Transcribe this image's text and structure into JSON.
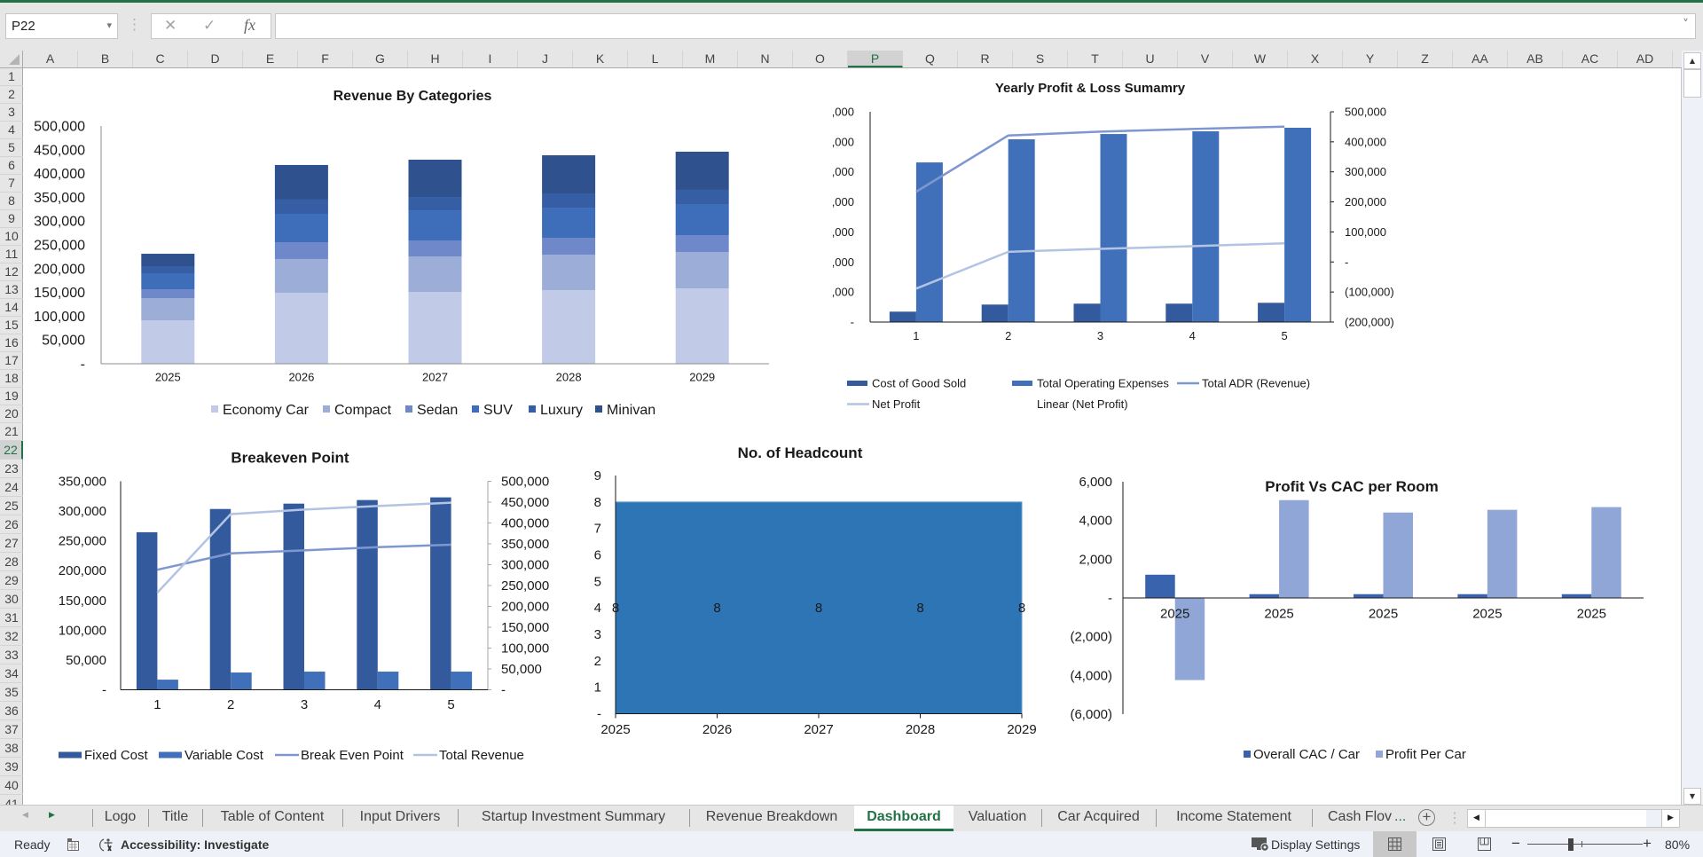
{
  "theme": {
    "accent": "#217346"
  },
  "formula_bar": {
    "name_box": "P22",
    "formula": "",
    "icons": {
      "name_box_dropdown": "▾",
      "grip": "⋮",
      "cancel": "✕",
      "enter": "✓",
      "insert_function": "fx",
      "expand_formula": "˅"
    }
  },
  "grid": {
    "columns": [
      "A",
      "B",
      "C",
      "D",
      "E",
      "F",
      "G",
      "H",
      "I",
      "J",
      "K",
      "L",
      "M",
      "N",
      "O",
      "P",
      "Q",
      "R",
      "S",
      "T",
      "U",
      "V",
      "W",
      "X",
      "Y",
      "Z",
      "AA",
      "AB",
      "AC",
      "AD"
    ],
    "rows": [
      "1",
      "2",
      "3",
      "4",
      "5",
      "6",
      "7",
      "8",
      "9",
      "10",
      "11",
      "12",
      "13",
      "14",
      "15",
      "16",
      "17",
      "18",
      "19",
      "20",
      "21",
      "22",
      "23",
      "24",
      "25",
      "26",
      "27",
      "28",
      "29",
      "30",
      "31",
      "32",
      "33",
      "34",
      "35",
      "36",
      "37",
      "38",
      "39",
      "40",
      "41"
    ],
    "selected_column": "P",
    "selected_row": "22"
  },
  "scrollbars": {
    "up_icon": "▲",
    "down_icon": "▼",
    "left_icon": "◀",
    "right_icon": "▶"
  },
  "sheet_tabs": {
    "prev_icon": "◀",
    "next_icon": "▶",
    "tabs": [
      {
        "label": "Logo"
      },
      {
        "label": "Title"
      },
      {
        "label": "Table of Content"
      },
      {
        "label": "Input Drivers"
      },
      {
        "label": "Startup Investment Summary"
      },
      {
        "label": "Revenue Breakdown"
      },
      {
        "label": "Dashboard"
      },
      {
        "label": "Valuation"
      },
      {
        "label": "Car Acquired"
      },
      {
        "label": "Income Statement"
      },
      {
        "label": "Cash Flov"
      }
    ],
    "active_tab": "Dashboard",
    "overflow_indicator": "...",
    "add_icon": "+",
    "options_icon": "⋮"
  },
  "status_bar": {
    "mode": "Ready",
    "accessibility": "Accessibility: Investigate",
    "display_settings": "Display Settings",
    "zoom_out_icon": "−",
    "zoom_in_icon": "+",
    "zoom_level": "80%",
    "zoom_percent": 80
  },
  "chart_data": [
    {
      "id": "revenue-by-categories",
      "type": "bar",
      "stacked": true,
      "title": "Revenue By Categories",
      "xlabel": "",
      "ylabel": "",
      "categories": [
        "2025",
        "2026",
        "2027",
        "2028",
        "2029"
      ],
      "series": [
        {
          "name": "Economy Car",
          "color": "#c1cbe8",
          "values": [
            91400,
            149300,
            151100,
            154900,
            158600
          ]
        },
        {
          "name": "Compact",
          "color": "#9cadd7",
          "values": [
            46600,
            70900,
            74600,
            74600,
            76500
          ]
        },
        {
          "name": "Sedan",
          "color": "#6e88c9",
          "values": [
            18700,
            35400,
            33600,
            35400,
            35400
          ]
        },
        {
          "name": "SUV",
          "color": "#3e6db9",
          "values": [
            33600,
            59700,
            63400,
            63400,
            65300
          ]
        },
        {
          "name": "Luxury",
          "color": "#365ea5",
          "values": [
            14900,
            29900,
            28000,
            29900,
            29900
          ]
        },
        {
          "name": "Minivan",
          "color": "#2f528f",
          "values": [
            26100,
            72800,
            78400,
            80200,
            80200
          ]
        }
      ],
      "ylim": [
        0,
        500000
      ],
      "yticks": [
        0,
        50000,
        100000,
        150000,
        200000,
        250000,
        300000,
        350000,
        400000,
        450000,
        500000
      ],
      "ytick_labels": [
        "-",
        "50,000",
        "100,000",
        "150,000",
        "200,000",
        "250,000",
        "300,000",
        "350,000",
        "400,000",
        "450,000",
        "500,000"
      ],
      "grid": false,
      "legend": "bottom"
    },
    {
      "id": "yearly-profit-loss-summary",
      "type": "bar",
      "combo": true,
      "title": "Yearly Profit & Loss Sumamry",
      "xlabel": "",
      "ylabel": "",
      "categories": [
        "1",
        "2",
        "3",
        "4",
        "5"
      ],
      "series": [
        {
          "name": "Cost of Good Sold",
          "type": "bar",
          "axis": "primary",
          "color": "#335a9c",
          "values": [
            17300,
            29100,
            30600,
            30600,
            32000
          ]
        },
        {
          "name": "Total Operating Expenses",
          "type": "bar",
          "axis": "primary",
          "color": "#4170ba",
          "values": [
            265700,
            304200,
            313000,
            317500,
            323400
          ]
        },
        {
          "name": "Total ADR (Revenue)",
          "type": "line",
          "axis": "secondary",
          "color": "#7f97d0",
          "values": [
            233800,
            421100,
            433900,
            442800,
            450700
          ]
        },
        {
          "name": "Net Profit",
          "type": "line",
          "axis": "secondary",
          "color": "#b4c3e4",
          "values": [
            -88600,
            33700,
            43500,
            52400,
            62300
          ]
        }
      ],
      "legend_extra": [
        "Linear (Net Profit)"
      ],
      "ylim": [
        0,
        350000
      ],
      "yticks": [
        0,
        50000,
        100000,
        150000,
        200000,
        250000,
        300000,
        350000
      ],
      "ytick_labels": [
        "-",
        ",000",
        ",000",
        ",000",
        ",000",
        ",000",
        ",000",
        ",000"
      ],
      "y2lim": [
        -200000,
        500000
      ],
      "y2ticks": [
        -200000,
        -100000,
        0,
        100000,
        200000,
        300000,
        400000,
        500000
      ],
      "y2tick_labels": [
        "(200,000)",
        "(100,000)",
        "-",
        "100,000",
        "200,000",
        "300,000",
        "400,000",
        "500,000"
      ],
      "grid": false,
      "legend": "bottom"
    },
    {
      "id": "breakeven-point",
      "type": "bar",
      "combo": true,
      "title": "Breakeven Point",
      "xlabel": "",
      "ylabel": "",
      "categories": [
        "1",
        "2",
        "3",
        "4",
        "5"
      ],
      "series": [
        {
          "name": "Fixed Cost",
          "type": "bar",
          "axis": "primary",
          "color": "#335a9c",
          "values": [
            264500,
            303500,
            312500,
            318500,
            323000
          ]
        },
        {
          "name": "Variable Cost",
          "type": "bar",
          "axis": "primary",
          "color": "#4170ba",
          "values": [
            17000,
            29000,
            30500,
            30500,
            30500
          ]
        },
        {
          "name": "Break Even Point",
          "type": "line",
          "axis": "secondary",
          "color": "#7f97d0",
          "values": [
            287900,
            327100,
            334300,
            342100,
            347900
          ]
        },
        {
          "name": "Total Revenue",
          "type": "line",
          "axis": "secondary",
          "color": "#b4c3e4",
          "values": [
            232900,
            421400,
            432100,
            440700,
            448600
          ]
        }
      ],
      "ylim": [
        0,
        350000
      ],
      "yticks": [
        0,
        50000,
        100000,
        150000,
        200000,
        250000,
        300000,
        350000
      ],
      "ytick_labels": [
        "-",
        "50,000",
        "100,000",
        "150,000",
        "200,000",
        "250,000",
        "300,000",
        "350,000"
      ],
      "y2lim": [
        0,
        500000
      ],
      "y2ticks": [
        0,
        50000,
        100000,
        150000,
        200000,
        250000,
        300000,
        350000,
        400000,
        450000,
        500000
      ],
      "y2tick_labels": [
        "-",
        "50,000",
        "100,000",
        "150,000",
        "200,000",
        "250,000",
        "300,000",
        "350,000",
        "400,000",
        "450,000",
        "500,000"
      ],
      "grid": false,
      "legend": "bottom"
    },
    {
      "id": "no-of-headcount",
      "type": "area",
      "title": "No. of Headcount",
      "xlabel": "",
      "ylabel": "",
      "categories": [
        "2025",
        "2026",
        "2027",
        "2028",
        "2029"
      ],
      "series": [
        {
          "color": "#2e75b6",
          "values": [
            8,
            8,
            8,
            8,
            8
          ]
        }
      ],
      "data_labels": [
        "8",
        "8",
        "8",
        "8",
        "8"
      ],
      "ylim": [
        0,
        9
      ],
      "yticks": [
        0,
        1,
        2,
        3,
        4,
        5,
        6,
        7,
        8,
        9
      ],
      "ytick_labels": [
        "-",
        "1",
        "2",
        "3",
        "4",
        "5",
        "6",
        "7",
        "8",
        "9"
      ],
      "grid": false,
      "legend": "none"
    },
    {
      "id": "profit-vs-cac-per-room",
      "type": "bar",
      "title": "Profit Vs CAC per Room",
      "xlabel": "",
      "ylabel": "",
      "categories": [
        "2025",
        "2025",
        "2025",
        "2025",
        "2025"
      ],
      "series": [
        {
          "name": "Overall CAC / Car",
          "color": "#3a63ad",
          "values": [
            1200,
            195,
            195,
            195,
            195
          ]
        },
        {
          "name": "Profit Per Car",
          "color": "#8fa6d7",
          "values": [
            -4240,
            5050,
            4410,
            4550,
            4690
          ]
        }
      ],
      "ylim": [
        -6000,
        6000
      ],
      "yticks": [
        -6000,
        -4000,
        -2000,
        0,
        2000,
        4000,
        6000
      ],
      "ytick_labels": [
        "(6,000)",
        "(4,000)",
        "(2,000)",
        "-",
        "2,000",
        "4,000",
        "6,000"
      ],
      "grid": false,
      "legend": "bottom"
    }
  ]
}
